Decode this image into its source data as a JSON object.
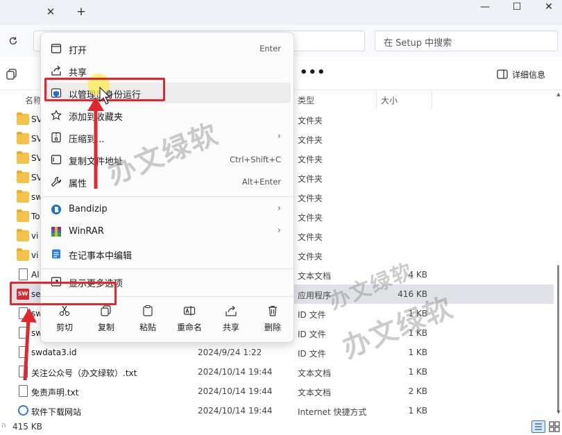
{
  "window": {
    "tab_close_glyph": "✕",
    "tab_new_glyph": "+",
    "minimize_glyph": "—",
    "maximize_glyph": "☐",
    "close_glyph": "✕"
  },
  "address": {
    "search_placeholder": "在 Setup 中搜索"
  },
  "toolbar": {
    "more_glyph": "•••",
    "details_label": "详细信息"
  },
  "file_list": {
    "columns": {
      "name": "名称",
      "type": "类型",
      "size": "大小"
    },
    "rows": [
      {
        "name": "SV",
        "date": "",
        "type": "文件夹",
        "size": "",
        "icon": "folder-icon"
      },
      {
        "name": "SV",
        "date": "",
        "type": "文件夹",
        "size": "",
        "icon": "folder-icon"
      },
      {
        "name": "SV",
        "date": "",
        "type": "文件夹",
        "size": "",
        "icon": "folder-icon"
      },
      {
        "name": "SV",
        "date": "",
        "type": "文件夹",
        "size": "",
        "icon": "folder-icon"
      },
      {
        "name": "sw",
        "date": "",
        "type": "文件夹",
        "size": "",
        "icon": "folder-icon"
      },
      {
        "name": "To",
        "date": "",
        "type": "文件夹",
        "size": "",
        "icon": "folder-icon"
      },
      {
        "name": "vi",
        "date": "",
        "type": "文件夹",
        "size": "",
        "icon": "folder-icon"
      },
      {
        "name": "vi",
        "date": "",
        "type": "文件夹",
        "size": "",
        "icon": "folder-icon"
      },
      {
        "name": "Al",
        "date": "",
        "type": "文本文档",
        "size": "4 KB",
        "icon": "text-file-icon"
      },
      {
        "name": "se",
        "date": "",
        "type": "应用程序",
        "size": "416 KB",
        "icon": "app-icon"
      },
      {
        "name": "sw",
        "date": "",
        "type": "ID 文件",
        "size": "1 KB",
        "icon": "text-file-icon"
      },
      {
        "name": "sw",
        "date": "",
        "type": "ID 文件",
        "size": "1 KB",
        "icon": "text-file-icon"
      },
      {
        "name": "swdata3.id",
        "date": "2024/9/24 1:22",
        "type": "ID 文件",
        "size": "1 KB",
        "icon": "text-file-icon"
      },
      {
        "name": "关注公众号（办文绿软）.txt",
        "date": "2024/10/14 19:44",
        "type": "文本文档",
        "size": "1 KB",
        "icon": "text-file-icon"
      },
      {
        "name": "免责声明.txt",
        "date": "2024/10/14 19:44",
        "type": "文本文档",
        "size": "2 KB",
        "icon": "text-file-icon"
      },
      {
        "name": "软件下载网站",
        "date": "2024/10/14 19:44",
        "type": "Internet 快捷方式",
        "size": "1 KB",
        "icon": "link-icon"
      }
    ]
  },
  "status": {
    "mark": "ה",
    "selection_size": "415 KB"
  },
  "context_menu": {
    "items": [
      {
        "label": "打开",
        "shortcut": "Enter",
        "icon": "open-icon"
      },
      {
        "label": "共享",
        "shortcut": "",
        "icon": "share-icon"
      },
      {
        "label": "以管理员身份运行",
        "shortcut": "",
        "icon": "shield-icon"
      },
      {
        "label": "添加到收藏夹",
        "shortcut": "",
        "icon": "star-icon"
      },
      {
        "label": "压缩到...",
        "shortcut": "",
        "icon": "zip-icon",
        "arrow": "›"
      },
      {
        "label": "复制文件地址",
        "shortcut": "Ctrl+Shift+C",
        "icon": "copy-path-icon"
      },
      {
        "label": "属性",
        "shortcut": "Alt+Enter",
        "icon": "wrench-icon"
      },
      {
        "label": "Bandizip",
        "shortcut": "",
        "icon": "bandizip-icon",
        "arrow": "›"
      },
      {
        "label": "WinRAR",
        "shortcut": "",
        "icon": "winrar-icon",
        "arrow": "›"
      },
      {
        "label": "在记事本中编辑",
        "shortcut": "",
        "icon": "notepad-icon"
      },
      {
        "label": "显示更多选项",
        "shortcut": "",
        "icon": "more-options-icon"
      }
    ],
    "quick_actions": [
      {
        "label": "剪切",
        "icon": "scissors-icon"
      },
      {
        "label": "复制",
        "icon": "copy-icon"
      },
      {
        "label": "粘贴",
        "icon": "paste-icon"
      },
      {
        "label": "重命名",
        "icon": "rename-icon"
      },
      {
        "label": "共享",
        "icon": "share-icon"
      },
      {
        "label": "删除",
        "icon": "trash-icon"
      }
    ]
  },
  "annotations": {
    "watermark": "办文绿软",
    "accent_color": "#e0272e"
  }
}
